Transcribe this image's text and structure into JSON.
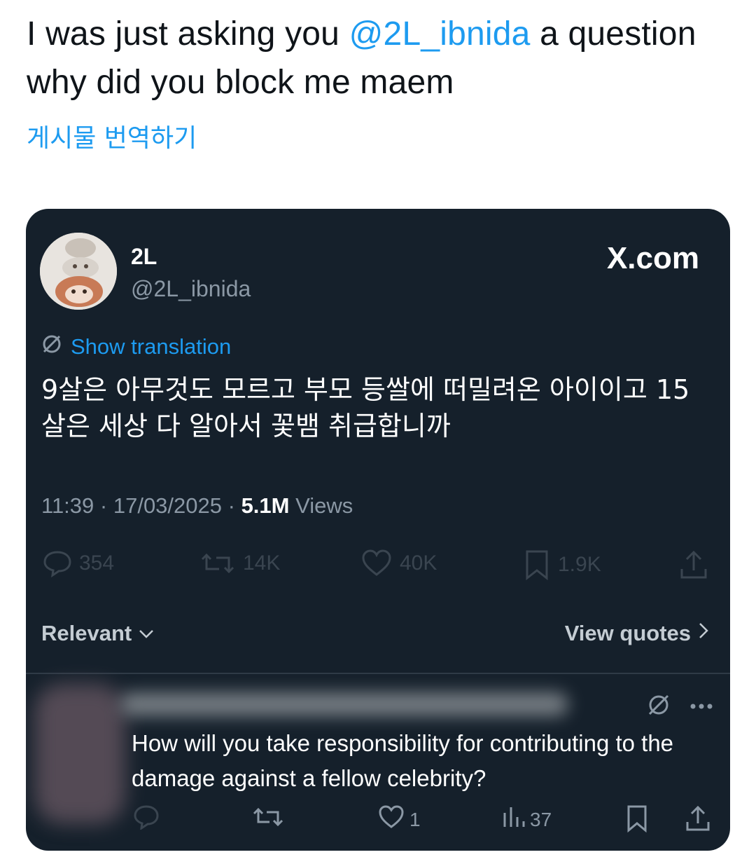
{
  "tweet": {
    "text_before": "I was just asking you ",
    "mention": "@2L_ibnida",
    "text_after": " a question why did you block me maem",
    "translate_label": "게시물 번역하기"
  },
  "embedded_post": {
    "author_name": "2L",
    "author_handle": "@2L_ibnida",
    "site_label": "X.com",
    "show_translation_label": "Show translation",
    "body": "9살은 아무것도 모르고 부모 등쌀에 떠밀려온 아이이고 15살은 세상 다 알아서 꽃뱀 취급합니까",
    "time": "11:39",
    "date": "17/03/2025",
    "views_count": "5.1M",
    "views_label": "Views",
    "separator": " · ",
    "stats": {
      "replies": "354",
      "reposts": "14K",
      "likes": "40K",
      "bookmarks": "1.9K"
    },
    "sort_label": "Relevant",
    "view_quotes_label": "View quotes"
  },
  "reply": {
    "text": "How will you take responsibility for contributing to the damage against a fellow celebrity?",
    "likes": "1",
    "views": "37"
  },
  "colors": {
    "accent": "#1d9bf0",
    "card_bg": "#15202b",
    "muted": "#8b98a5"
  }
}
